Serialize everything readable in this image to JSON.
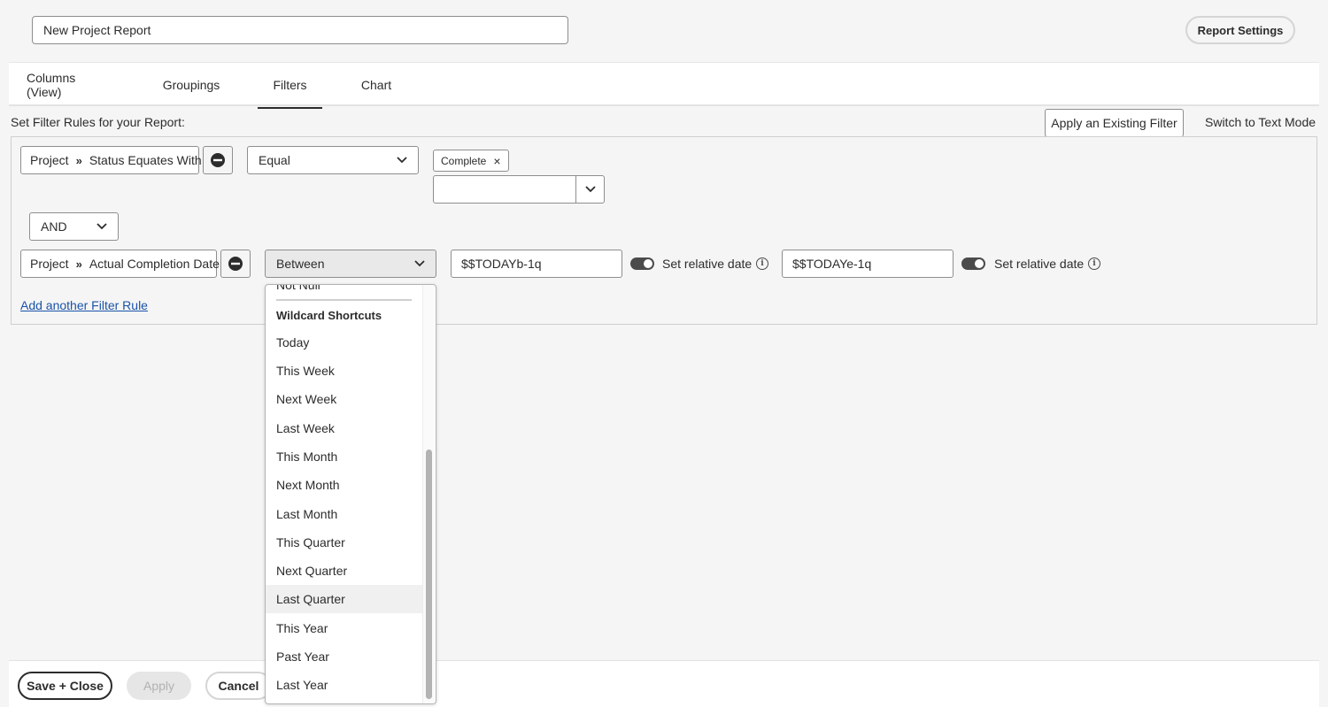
{
  "header": {
    "report_name": "New Project Report",
    "settings_label": "Report Settings"
  },
  "tabs": [
    {
      "label": "Columns (View)",
      "active": false
    },
    {
      "label": "Groupings",
      "active": false
    },
    {
      "label": "Filters",
      "active": true
    },
    {
      "label": "Chart",
      "active": false
    }
  ],
  "filters": {
    "section_label": "Set Filter Rules for your Report:",
    "apply_existing_label": "Apply an Existing Filter",
    "switch_text_mode_label": "Switch to Text Mode",
    "rule1": {
      "object": "Project",
      "field": "Status Equates With",
      "operator": "Equal",
      "chip": "Complete",
      "chip_remove": "×",
      "combo_value": ""
    },
    "conjunction": "AND",
    "rule2": {
      "object": "Project",
      "field": "Actual Completion Date",
      "operator": "Between",
      "value_start": "$$TODAYb-1q",
      "value_end": "$$TODAYe-1q",
      "relative_label": "Set relative date",
      "relative_start_on": true,
      "relative_end_on": true
    },
    "add_rule_label": "Add another Filter Rule"
  },
  "dropdown": {
    "partial_item": "Not Null",
    "group_header": "Wildcard Shortcuts",
    "items": [
      "Today",
      "This Week",
      "Next Week",
      "Last Week",
      "This Month",
      "Next Month",
      "Last Month",
      "This Quarter",
      "Next Quarter",
      "Last Quarter",
      "This Year",
      "Past Year",
      "Last Year"
    ],
    "highlighted": "Last Quarter"
  },
  "footer": {
    "save_close": "Save + Close",
    "apply": "Apply",
    "cancel": "Cancel"
  },
  "icons": {
    "chevron_separator": "»",
    "info": "i"
  },
  "colors": {
    "link": "#1a53a8",
    "toggle_on": "#4b4b4b"
  }
}
